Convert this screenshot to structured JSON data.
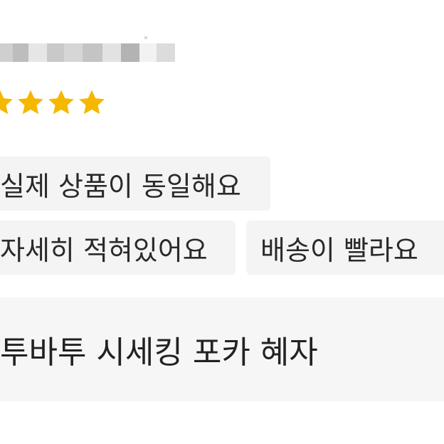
{
  "reviewer": {
    "name_masked": true
  },
  "rating": {
    "stars": 4,
    "star_color": "#f5b700",
    "icon": "star-icon"
  },
  "tags": [
    {
      "label": "실제 상품이 동일해요"
    },
    {
      "label": "자세히 적혀있어요"
    },
    {
      "label": "배송이 빨라요"
    }
  ],
  "product": {
    "name": "투바투 시세킹 포카 혜자"
  },
  "colors": {
    "tag_bg": "#f4f4f4",
    "product_bg": "#f6f6f6",
    "text": "#2a2a2a"
  }
}
